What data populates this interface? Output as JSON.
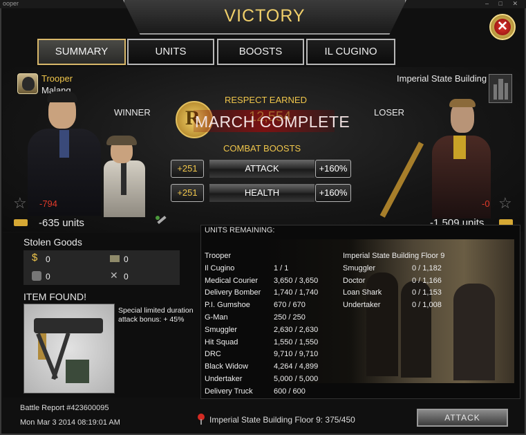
{
  "window": {
    "caption": "ooper"
  },
  "title": "VICTORY",
  "tabs": [
    "SUMMARY",
    "UNITS",
    "BOOSTS",
    "IL CUGINO"
  ],
  "winner": {
    "name": "Trooper",
    "location": "Malang",
    "role_label": "WINNER",
    "loss": "-794",
    "units": "-635 units"
  },
  "loser": {
    "name": "Imperial State Building",
    "role_label": "LOSER",
    "loss": "-0",
    "units": "-1,509 units"
  },
  "respect": {
    "label": "RESPECT EARNED",
    "value": "12,554",
    "overlay": "MARCH COMPLETE"
  },
  "combat_boosts": {
    "label": "COMBAT BOOSTS",
    "rows": [
      {
        "plus": "+251",
        "name": "ATTACK",
        "pct": "+160%"
      },
      {
        "plus": "+251",
        "name": "HEALTH",
        "pct": "+160%"
      }
    ]
  },
  "stolen_goods": {
    "title": "Stolen Goods",
    "items": [
      {
        "icon": "cash-icon",
        "value": "0"
      },
      {
        "icon": "ammo-crate-icon",
        "value": "0"
      },
      {
        "icon": "barrel-icon",
        "value": "0"
      },
      {
        "icon": "tools-icon",
        "value": "0"
      }
    ]
  },
  "item_found": {
    "title": "ITEM FOUND!",
    "description": "Special limited duration attack bonus: + 45%",
    "icon": "machine-gun-icon"
  },
  "units_remaining": {
    "title": "UNITS REMAINING:",
    "attacker": [
      {
        "name": "Trooper",
        "count": ""
      },
      {
        "name": "Il Cugino",
        "count": "1 / 1"
      },
      {
        "name": "Medical Courier",
        "count": "3,650 / 3,650"
      },
      {
        "name": "Delivery Bomber",
        "count": "1,740 / 1,740"
      },
      {
        "name": "P.I. Gumshoe",
        "count": "670 / 670"
      },
      {
        "name": "G-Man",
        "count": "250 / 250"
      },
      {
        "name": "Smuggler",
        "count": "2,630 / 2,630"
      },
      {
        "name": "Hit Squad",
        "count": "1,550 / 1,550"
      },
      {
        "name": "DRC",
        "count": "9,710 / 9,710"
      },
      {
        "name": "Black Widow",
        "count": "4,264 / 4,899"
      },
      {
        "name": "Undertaker",
        "count": "5,000 / 5,000"
      },
      {
        "name": "Delivery Truck",
        "count": "600 / 600"
      }
    ],
    "defender": [
      {
        "name": "Imperial State Building Floor 9",
        "count": ""
      },
      {
        "name": "Smuggler",
        "count": "0 / 1,182"
      },
      {
        "name": "Doctor",
        "count": "0 / 1,166"
      },
      {
        "name": "Loan Shark",
        "count": "0 / 1,153"
      },
      {
        "name": "Undertaker",
        "count": "0 / 1,008"
      }
    ]
  },
  "footer": {
    "report": "Battle Report #423600095",
    "date": "Mon Mar 3 2014 08:19:01 AM",
    "target": "Imperial State Building Floor 9: 375/450",
    "attack_button": "ATTACK"
  },
  "colors": {
    "gold": "#f0c64b",
    "red": "#e23a2a",
    "accent_gold_border": "#d9b86a"
  }
}
